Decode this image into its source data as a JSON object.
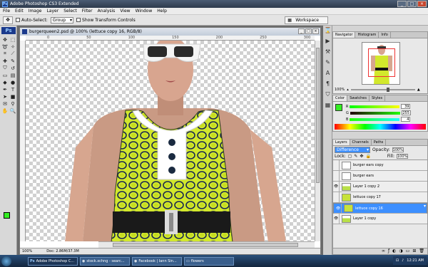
{
  "app": {
    "title": "Adobe Photoshop CS3 Extended",
    "logo": "Ps"
  },
  "window_buttons": [
    "_",
    "□",
    "×"
  ],
  "menu": [
    "File",
    "Edit",
    "Image",
    "Layer",
    "Select",
    "Filter",
    "Analysis",
    "View",
    "Window",
    "Help"
  ],
  "options": {
    "auto_select_label": "Auto-Select:",
    "auto_select_value": "Group",
    "transform_label": "Show Transform Controls",
    "workspace": "Workspace"
  },
  "document": {
    "title": "burgerqueen2.psd @ 100% (lettuce copy 16, RGB/8)",
    "ruler_marks": [
      "0",
      "50",
      "100",
      "150",
      "200",
      "250",
      "300",
      "350"
    ],
    "zoom": "100%",
    "doc_size": "Doc: 2.86M/37.3M"
  },
  "navigator": {
    "tabs": [
      "Navigator",
      "Histogram",
      "Info"
    ],
    "zoom": "100%"
  },
  "color": {
    "tabs": [
      "Color",
      "Swatches",
      "Styles"
    ],
    "fg": "#33ee22",
    "channels": [
      {
        "label": "R",
        "value": "39"
      },
      {
        "label": "G",
        "value": "255"
      },
      {
        "label": "B",
        "value": "4"
      }
    ]
  },
  "layers": {
    "tabs": [
      "Layers",
      "Channels",
      "Paths"
    ],
    "blend": "Difference",
    "opacity_label": "Opacity:",
    "opacity": "100%",
    "lock_label": "Lock:",
    "fill_label": "Fill:",
    "fill": "100%",
    "rows": [
      {
        "name": "burger ears copy",
        "thumb": "plain",
        "visible": false,
        "selected": false
      },
      {
        "name": "burger ears",
        "thumb": "plain",
        "visible": false,
        "selected": false
      },
      {
        "name": "Layer 1 copy 2",
        "thumb": "person",
        "visible": true,
        "selected": false
      },
      {
        "name": "lettuce copy 17",
        "thumb": "green",
        "visible": false,
        "selected": false
      },
      {
        "name": "lettuce copy 16",
        "thumb": "green",
        "visible": true,
        "selected": true
      },
      {
        "name": "Layer 1 copy",
        "thumb": "person",
        "visible": true,
        "selected": false
      }
    ]
  },
  "taskbar": {
    "items": [
      {
        "label": "Adobe Photoshop C...",
        "active": true
      },
      {
        "label": "stock.xchng - searc...",
        "active": false
      },
      {
        "label": "Facebook | Iann Sin...",
        "active": false
      },
      {
        "label": "flowers",
        "active": false
      }
    ],
    "clock": "12:21 AM"
  }
}
